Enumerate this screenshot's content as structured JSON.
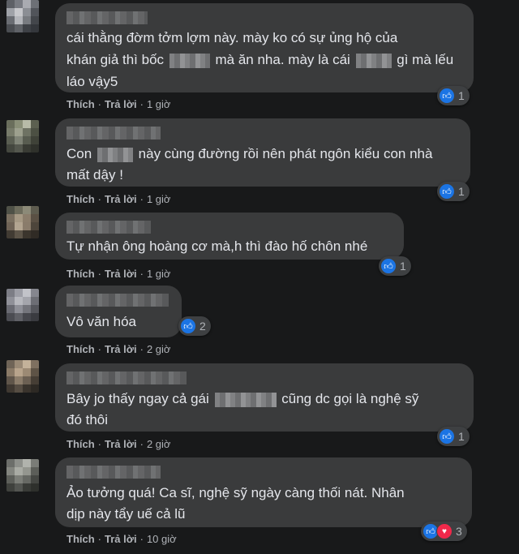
{
  "comments": [
    {
      "lines": [
        [
          "cái thằng đờm tởm lợm này. mày ko có sự ủng hộ của"
        ],
        [
          "khán giả thì bốc",
          "",
          "mà ăn nha. mày là cái",
          "",
          "gì mà lếu"
        ],
        [
          "láo vậy5"
        ]
      ],
      "reactions": [
        {
          "icon": "like-icon"
        }
      ],
      "reaction_count": "1",
      "like": "Thích",
      "reply": "Trả lời",
      "time": "1 giờ"
    },
    {
      "lines": [
        [
          "Con",
          "",
          "này cùng đường rồi nên phát ngôn kiểu con nhà"
        ],
        [
          "mất dậy !"
        ]
      ],
      "reactions": [
        {
          "icon": "like-icon"
        }
      ],
      "reaction_count": "1",
      "like": "Thích",
      "reply": "Trả lời",
      "time": "1 giờ"
    },
    {
      "lines": [
        [
          "Tự nhận ông hoàng cơ mà,h thì đào hố chôn nhé"
        ]
      ],
      "reactions": [
        {
          "icon": "like-icon"
        }
      ],
      "reaction_count": "1",
      "like": "Thích",
      "reply": "Trả lời",
      "time": "1 giờ"
    },
    {
      "lines": [
        [
          "Vô văn hóa"
        ]
      ],
      "reactions": [
        {
          "icon": "like-icon"
        }
      ],
      "reaction_count": "2",
      "like": "Thích",
      "reply": "Trả lời",
      "time": "2 giờ"
    },
    {
      "lines": [
        [
          "Bây jo thấy ngay cả gái",
          "",
          "cũng dc gọi là nghệ sỹ"
        ],
        [
          "đó thôi"
        ]
      ],
      "reactions": [
        {
          "icon": "like-icon"
        }
      ],
      "reaction_count": "1",
      "like": "Thích",
      "reply": "Trả lời",
      "time": "2 giờ"
    },
    {
      "lines": [
        [
          "Ảo tưởng quá! Ca sĩ, nghệ sỹ ngày càng thối nát. Nhân"
        ],
        [
          "dịp này tẩy uế cả lũ"
        ]
      ],
      "reactions": [
        {
          "icon": "like-icon"
        },
        {
          "icon": "love-icon"
        }
      ],
      "reaction_count": "3",
      "like": "Thích",
      "reply": "Trả lời",
      "time": "10 giờ"
    }
  ],
  "colors": {
    "background": "#18191a",
    "bubble": "#3a3b3c",
    "text": "#e4e6eb",
    "secondary_text": "#b0b3b8",
    "like_blue": "#1b74e4",
    "love_red": "#f0284a"
  }
}
